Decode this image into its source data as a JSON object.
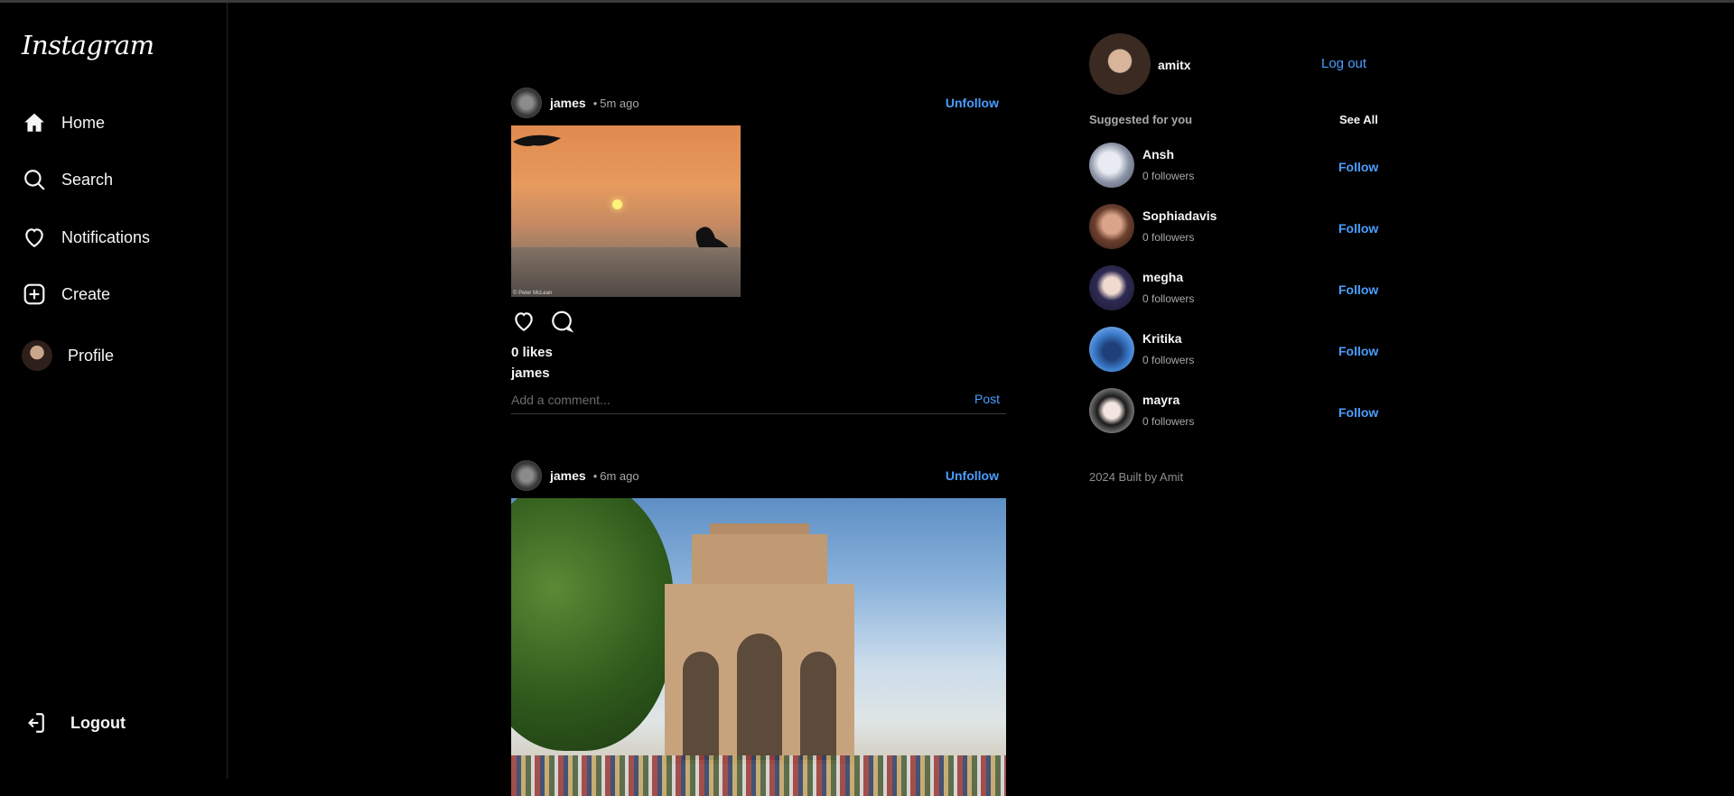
{
  "app": {
    "logo": "Instagram"
  },
  "sidebar": {
    "items": [
      {
        "label": "Home",
        "icon": "home-icon"
      },
      {
        "label": "Search",
        "icon": "search-icon"
      },
      {
        "label": "Notifications",
        "icon": "heart-icon"
      },
      {
        "label": "Create",
        "icon": "plus-square-icon"
      },
      {
        "label": "Profile",
        "icon": "avatar"
      }
    ],
    "logout": "Logout"
  },
  "feed": {
    "posts": [
      {
        "username": "james",
        "dot": "•",
        "time": "5m ago",
        "follow_label": "Unfollow",
        "image_credit": "© Peter McLean",
        "likes": "0 likes",
        "caption_user": "james",
        "comment_placeholder": "Add a comment...",
        "post_label": "Post"
      },
      {
        "username": "james",
        "dot": "•",
        "time": "6m ago",
        "follow_label": "Unfollow"
      }
    ]
  },
  "right": {
    "me": {
      "username": "amitx",
      "logout": "Log out"
    },
    "suggested_title": "Suggested for you",
    "see_all": "See All",
    "suggestions": [
      {
        "name": "Ansh",
        "followers": "0 followers",
        "action": "Follow"
      },
      {
        "name": "Sophiadavis",
        "followers": "0 followers",
        "action": "Follow"
      },
      {
        "name": "megha",
        "followers": "0 followers",
        "action": "Follow"
      },
      {
        "name": "Kritika",
        "followers": "0 followers",
        "action": "Follow"
      },
      {
        "name": "mayra",
        "followers": "0 followers",
        "action": "Follow"
      }
    ],
    "footer": "2024 Built by Amit"
  },
  "colors": {
    "background": "#000000",
    "accent": "#4a9eff",
    "muted": "#a8a8a8"
  }
}
